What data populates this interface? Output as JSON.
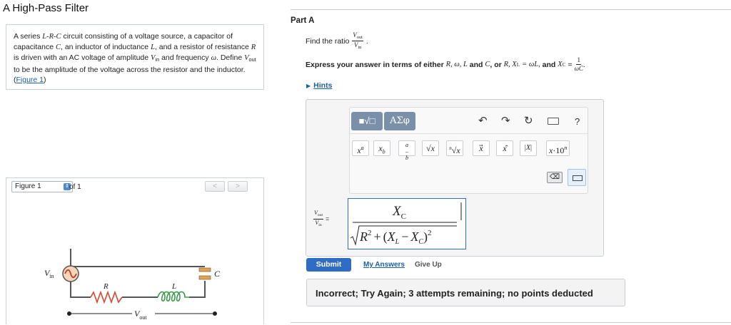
{
  "page": {
    "title": "A High-Pass Filter"
  },
  "intro": {
    "t1": "A series ",
    "circuit_type": "L-R-C",
    "t2": " circuit consisting of a voltage source, a capacitor of capacitance ",
    "c_sym": "C",
    "t3": ", an inductor of inductance ",
    "l_sym": "L",
    "t4": ", and a resistor of resistance ",
    "r_sym": "R",
    "t5": " is driven with an AC voltage of amplitude ",
    "vin_sym": "V",
    "vin_sub": "in",
    "t6": " and frequency ",
    "w_sym": "ω",
    "t7": ". Define ",
    "vout_sym": "V",
    "vout_sub": "out",
    "t8": " to be the amplitude of the voltage across the resistor and the inductor. (",
    "figure_link": "Figure 1",
    "t9": ")"
  },
  "figure": {
    "select_value": "Figure 1",
    "of_text": "of 1",
    "prev_label": "<",
    "next_label": ">",
    "labels": {
      "vin": "V",
      "vin_sub": "in",
      "r": "R",
      "l": "L",
      "c": "C",
      "vout": "V",
      "vout_sub": "out"
    }
  },
  "part": {
    "title": "Part A",
    "prompt": "Find the ratio",
    "ratio_num": "V",
    "ratio_num_sub": "out",
    "ratio_den": "V",
    "ratio_den_sub": "in",
    "ratio_end": ".",
    "instruction": {
      "lead": "Express your answer in terms of either",
      "vars1": "R, ω, L",
      "and1": "and",
      "c1": "C",
      "or": ", or",
      "vars2": "R, X",
      "xl_sub": "L",
      "xl_def": "= ωL,",
      "and2": "and",
      "xc": "X",
      "xc_sub": "C",
      "eq": "=",
      "xc_num": "1",
      "xc_den": "ωC",
      "end": "."
    },
    "hints_label": "Hints"
  },
  "toolbar": {
    "templates_label": "■√□",
    "symbols_label": "ΑΣφ",
    "undo_icon": "undo-icon",
    "redo_icon": "redo-icon",
    "reset_icon": "reset-icon",
    "keyboard_icon": "keyboard-icon",
    "help_label": "?",
    "buttons": [
      "xᵃ",
      "x_b",
      "a/b",
      "√x",
      "ⁿ√x",
      "x⃗",
      "x̂",
      "|x|",
      "x·10ⁿ"
    ],
    "backspace_label": "⌫"
  },
  "answer": {
    "label_num": "V",
    "label_num_sub": "out",
    "label_den": "V",
    "label_den_sub": "in",
    "label_eq": "=",
    "numerator": "X",
    "numerator_sub": "C",
    "den_r": "R",
    "den_exp": "2",
    "den_plus": "+",
    "den_xl": "X",
    "den_xl_sub": "L",
    "den_minus": "−",
    "den_xc": "X",
    "den_xc_sub": "C",
    "den_exp2": "2"
  },
  "actions": {
    "submit_label": "Submit",
    "my_answers_label": "My Answers",
    "give_up_label": "Give Up"
  },
  "feedback": {
    "text": "Incorrect; Try Again; 3 attempts remaining; no points deducted"
  },
  "colors": {
    "link": "#1a5fa8",
    "submit": "#2f6dc5",
    "wire": "#555555",
    "source_fill": "#f6d6b8",
    "source_wave": "#c0392b",
    "resistor": "#d9472b",
    "inductor": "#3a9a4a",
    "capacitor_plate": "#e6a24a"
  }
}
